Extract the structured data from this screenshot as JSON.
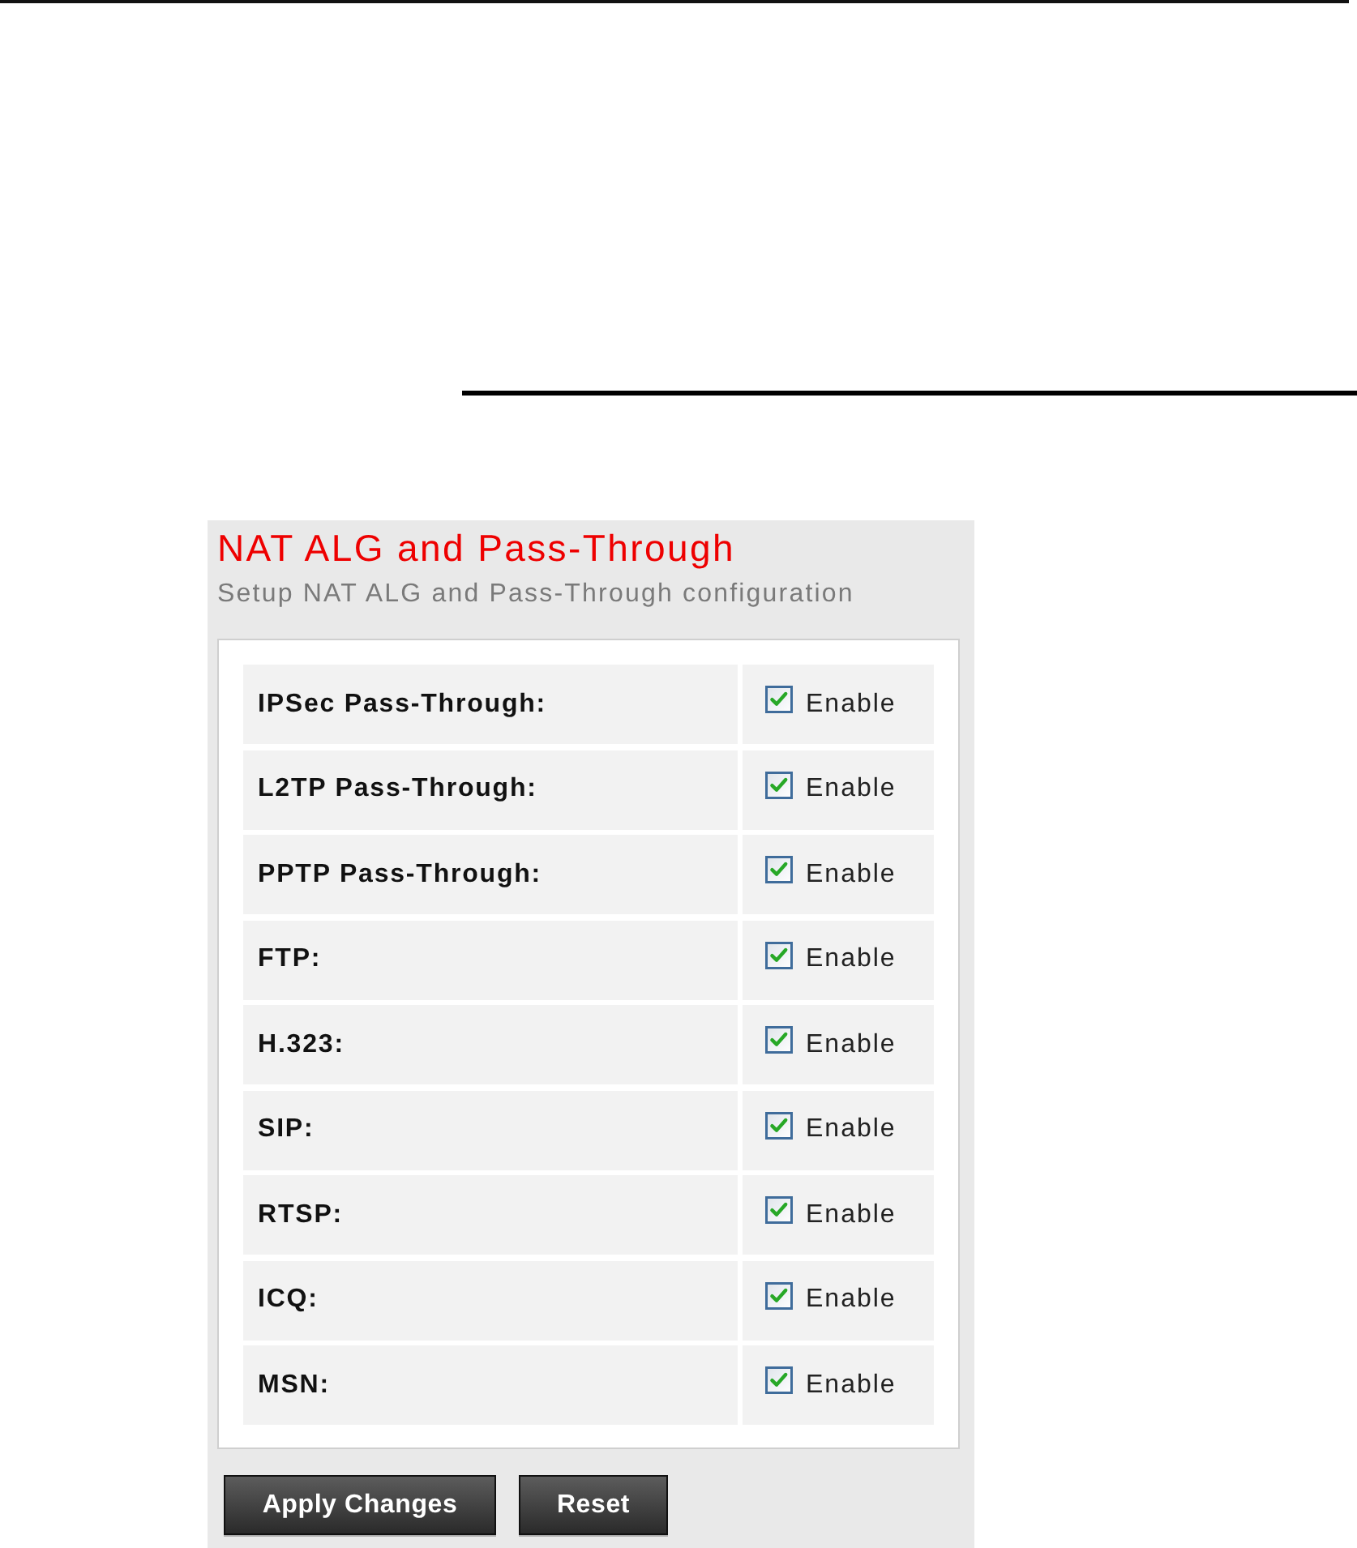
{
  "panel": {
    "title": "NAT ALG and Pass-Through",
    "subtitle": "Setup NAT ALG and Pass-Through configuration"
  },
  "settings": [
    {
      "label": "IPSec Pass-Through:",
      "option": "Enable",
      "checked": true
    },
    {
      "label": "L2TP Pass-Through:",
      "option": "Enable",
      "checked": true
    },
    {
      "label": "PPTP Pass-Through:",
      "option": "Enable",
      "checked": true
    },
    {
      "label": "FTP:",
      "option": "Enable",
      "checked": true
    },
    {
      "label": "H.323:",
      "option": "Enable",
      "checked": true
    },
    {
      "label": "SIP:",
      "option": "Enable",
      "checked": true
    },
    {
      "label": "RTSP:",
      "option": "Enable",
      "checked": true
    },
    {
      "label": "ICQ:",
      "option": "Enable",
      "checked": true
    },
    {
      "label": "MSN:",
      "option": "Enable",
      "checked": true
    }
  ],
  "buttons": [
    "Apply Changes",
    "Reset"
  ]
}
